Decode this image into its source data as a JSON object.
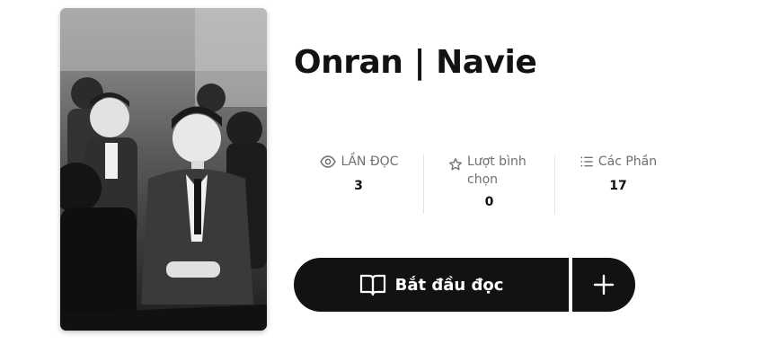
{
  "story": {
    "title": "Onran | Navie",
    "cover_alt": "Story cover"
  },
  "stats": {
    "reads": {
      "label": "LẦN ĐỌC",
      "value": "3",
      "icon": "eye-icon"
    },
    "votes": {
      "label": "Lượt bình chọn",
      "value": "0",
      "icon": "star-icon"
    },
    "parts": {
      "label": "Các Phần",
      "value": "17",
      "icon": "list-icon"
    }
  },
  "actions": {
    "start_label": "Bắt đầu đọc",
    "start_icon": "book-open-icon",
    "add_icon": "plus-icon"
  },
  "colors": {
    "button_bg": "#121212",
    "button_text": "#ffffff",
    "muted_text": "#6f6f6f",
    "divider": "#e4e4e4"
  }
}
